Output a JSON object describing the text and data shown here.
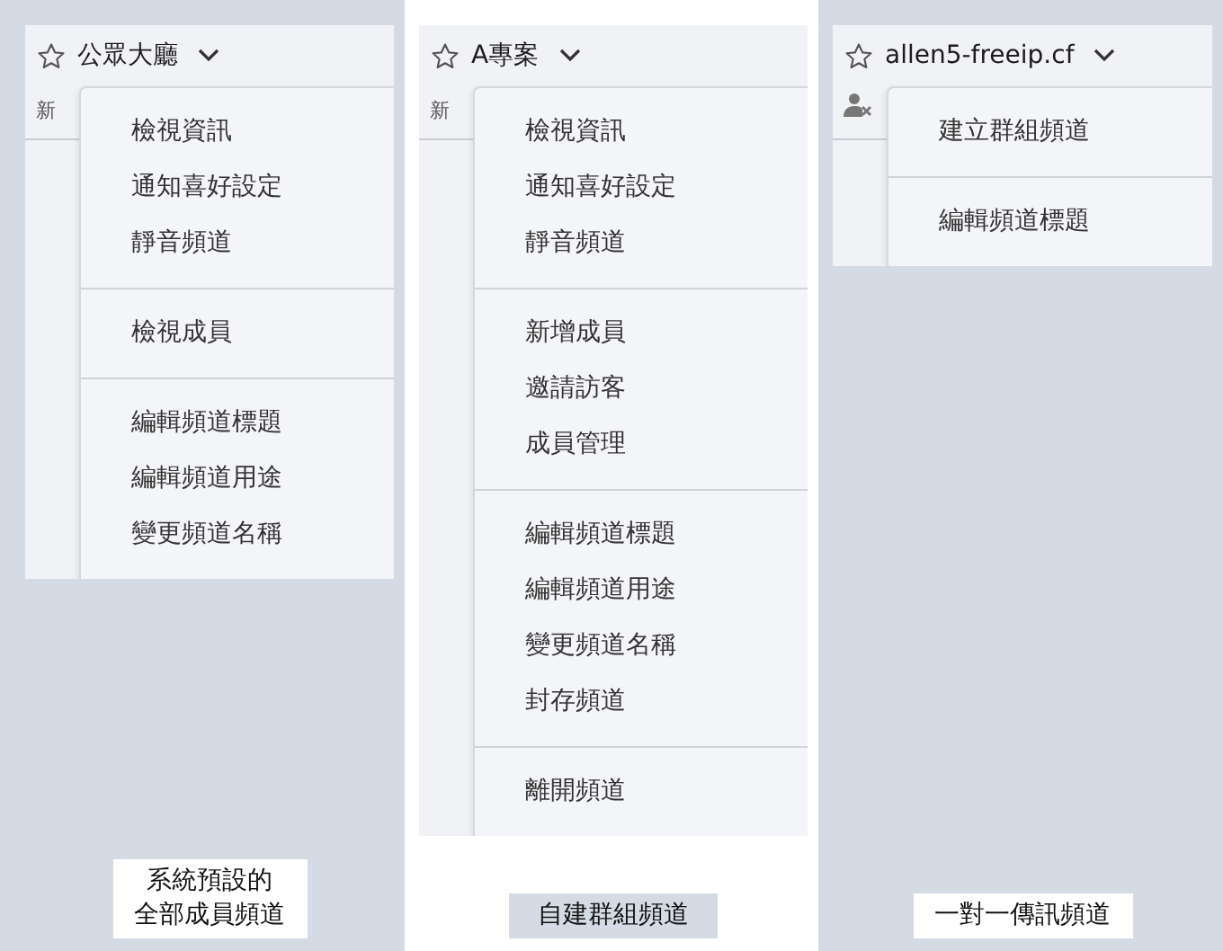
{
  "panels": [
    {
      "title": "公眾大廳",
      "selected": false,
      "subtitle": {
        "kind": "text",
        "text": "新"
      },
      "groups": [
        {
          "items": [
            "檢視資訊",
            "通知喜好設定",
            "靜音頻道"
          ]
        },
        {
          "items": [
            "檢視成員"
          ]
        },
        {
          "items": [
            "編輯頻道標題",
            "編輯頻道用途",
            "變更頻道名稱"
          ]
        }
      ],
      "caption": [
        "系統預設的",
        "全部成員頻道"
      ]
    },
    {
      "title": "A專案",
      "selected": true,
      "subtitle": {
        "kind": "text",
        "text": "新"
      },
      "groups": [
        {
          "items": [
            "檢視資訊",
            "通知喜好設定",
            "靜音頻道"
          ]
        },
        {
          "items": [
            "新增成員",
            "邀請訪客",
            "成員管理"
          ]
        },
        {
          "items": [
            "編輯頻道標題",
            "編輯頻道用途",
            "變更頻道名稱",
            "封存頻道"
          ]
        },
        {
          "items": [
            "離開頻道"
          ]
        }
      ],
      "caption": [
        "自建群組頻道"
      ]
    },
    {
      "title": "allen5-freeip.cf",
      "selected": false,
      "subtitle": {
        "kind": "icon"
      },
      "groups": [
        {
          "items": [
            "建立群組頻道"
          ]
        },
        {
          "items": [
            "編輯頻道標題"
          ]
        }
      ],
      "caption": [
        "一對一傳訊頻道"
      ]
    }
  ]
}
